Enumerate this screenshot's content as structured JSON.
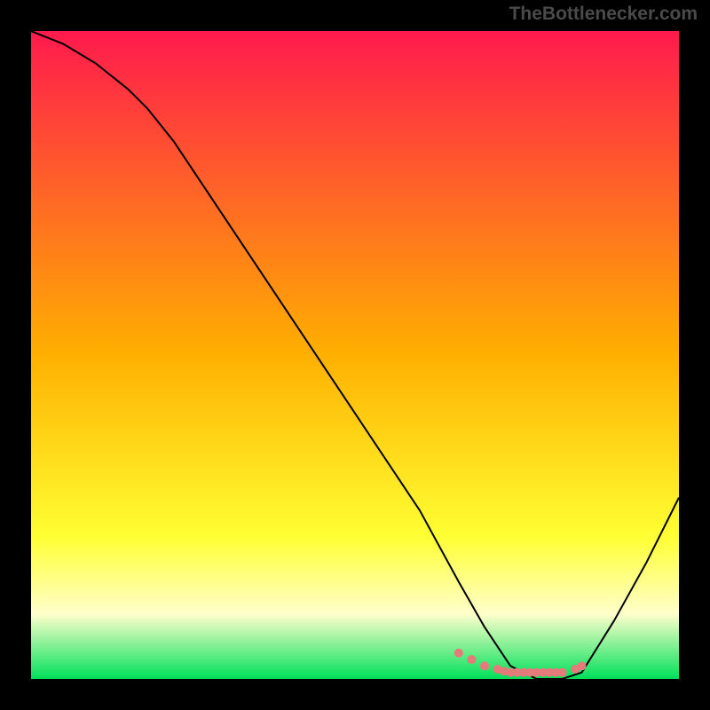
{
  "watermark": "TheBottlenecker.com",
  "chart_data": {
    "type": "line",
    "title": "",
    "xlabel": "",
    "ylabel": "",
    "xlim": [
      0,
      100
    ],
    "ylim": [
      0,
      100
    ],
    "grid": false,
    "background": {
      "type": "vertical-gradient",
      "stops": [
        {
          "offset": 0.0,
          "color": "#ff1a4d"
        },
        {
          "offset": 0.5,
          "color": "#ffb000"
        },
        {
          "offset": 0.78,
          "color": "#ffff33"
        },
        {
          "offset": 0.9,
          "color": "#ffffcc"
        },
        {
          "offset": 1.0,
          "color": "#00e05a"
        }
      ]
    },
    "series": [
      {
        "name": "bottleneck-curve",
        "color": "#000000",
        "x": [
          0,
          5,
          10,
          15,
          18,
          22,
          30,
          40,
          50,
          60,
          66,
          70,
          74,
          78,
          82,
          85,
          90,
          95,
          100
        ],
        "y": [
          100,
          98,
          95,
          91,
          88,
          83,
          71,
          56,
          41,
          26,
          15,
          8,
          2,
          0,
          0,
          1,
          9,
          18,
          28
        ]
      }
    ],
    "markers": {
      "name": "highlight-dots",
      "color": "#e47a7a",
      "radius": 5,
      "x": [
        66,
        68,
        70,
        72,
        73,
        74,
        75,
        76,
        77,
        78,
        79,
        80,
        81,
        82,
        84,
        85
      ],
      "y": [
        4,
        3,
        2,
        1.5,
        1.2,
        1,
        1,
        1,
        1,
        1,
        1,
        1,
        1,
        1,
        1.5,
        2
      ]
    }
  }
}
